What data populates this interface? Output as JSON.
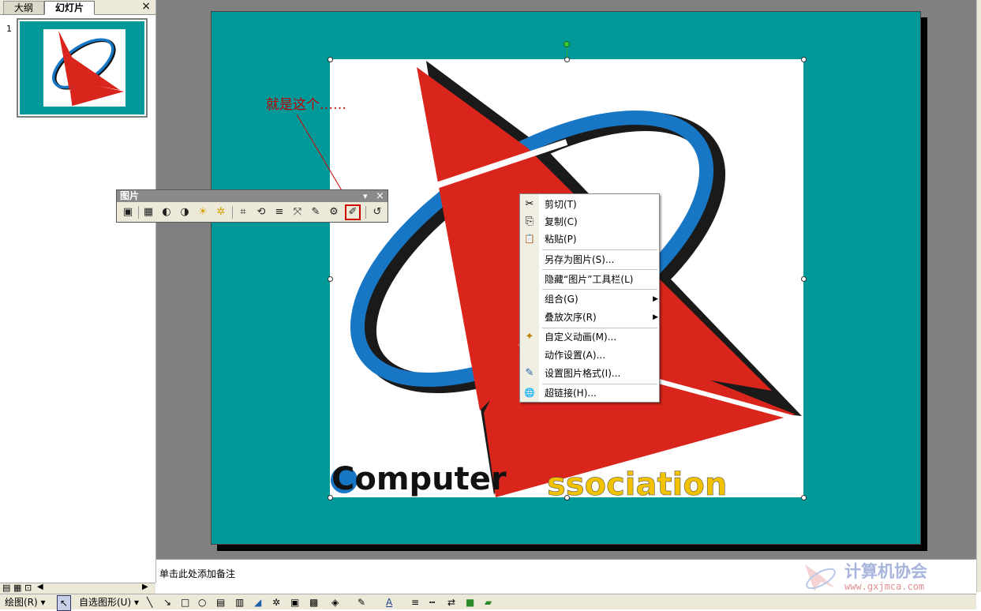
{
  "left_panel": {
    "tabs": [
      "大纲",
      "幻灯片"
    ],
    "close_glyph": "×",
    "slide_number": "1"
  },
  "annotation": {
    "text": "就是这个……"
  },
  "picture_toolbar": {
    "title": "图片",
    "dropdown_glyph": "▾",
    "close_glyph": "×",
    "tools": [
      {
        "icon": "insert-picture-icon",
        "glyph": "▣"
      },
      {
        "icon": "color-icon",
        "glyph": "▦"
      },
      {
        "icon": "more-contrast-icon",
        "glyph": "◐"
      },
      {
        "icon": "less-contrast-icon",
        "glyph": "◑"
      },
      {
        "icon": "more-brightness-icon",
        "glyph": "☀"
      },
      {
        "icon": "less-brightness-icon",
        "glyph": "✲"
      },
      {
        "icon": "crop-icon",
        "glyph": "⌗"
      },
      {
        "icon": "rotate-left-icon",
        "glyph": "⟲"
      },
      {
        "icon": "line-style-icon",
        "glyph": "≡"
      },
      {
        "icon": "compress-pictures-icon",
        "glyph": "⤧"
      },
      {
        "icon": "recolor-picture-icon",
        "glyph": "✎"
      },
      {
        "icon": "format-picture-icon",
        "glyph": "⚙"
      },
      {
        "icon": "set-transparent-color-icon",
        "glyph": "✐"
      },
      {
        "icon": "reset-picture-icon",
        "glyph": "↺"
      }
    ]
  },
  "context_menu": {
    "items": [
      {
        "label": "剪切(T)",
        "icon": "cut-icon",
        "glyph": "✂"
      },
      {
        "label": "复制(C)",
        "icon": "copy-icon",
        "glyph": "⎘"
      },
      {
        "label": "粘贴(P)",
        "icon": "paste-icon",
        "glyph": "📋"
      },
      {
        "label": "另存为图片(S)...",
        "icon": "",
        "glyph": ""
      },
      {
        "label": "隐藏“图片”工具栏(L)",
        "icon": "",
        "glyph": ""
      },
      {
        "label": "组合(G)",
        "icon": "",
        "glyph": "",
        "submenu": true
      },
      {
        "label": "叠放次序(R)",
        "icon": "",
        "glyph": "",
        "submenu": true
      },
      {
        "label": "自定义动画(M)...",
        "icon": "custom-animation-icon",
        "glyph": "✦"
      },
      {
        "label": "动作设置(A)...",
        "icon": "",
        "glyph": ""
      },
      {
        "label": "设置图片格式(I)...",
        "icon": "format-picture-icon",
        "glyph": "✎"
      },
      {
        "label": "超链接(H)...",
        "icon": "hyperlink-icon",
        "glyph": "🌐"
      }
    ],
    "submenu_glyph": "▶"
  },
  "notes": {
    "placeholder": "单击此处添加备注"
  },
  "drawing_toolbar": {
    "draw_label": "绘图(R)",
    "autoshapes_label": "自选图形(U)",
    "dropdown_glyph": "▾"
  },
  "logo": {
    "text_left": "Computer",
    "text_right": "ssociation"
  },
  "watermark": {
    "text": "计算机协会",
    "url": "www.gxjmca.com"
  },
  "colors": {
    "slide_background": "#009999",
    "logo_red": "#d9251c",
    "logo_blue": "#1777c4",
    "logo_yellow": "#f2c200",
    "highlight_red": "#cc0000"
  }
}
